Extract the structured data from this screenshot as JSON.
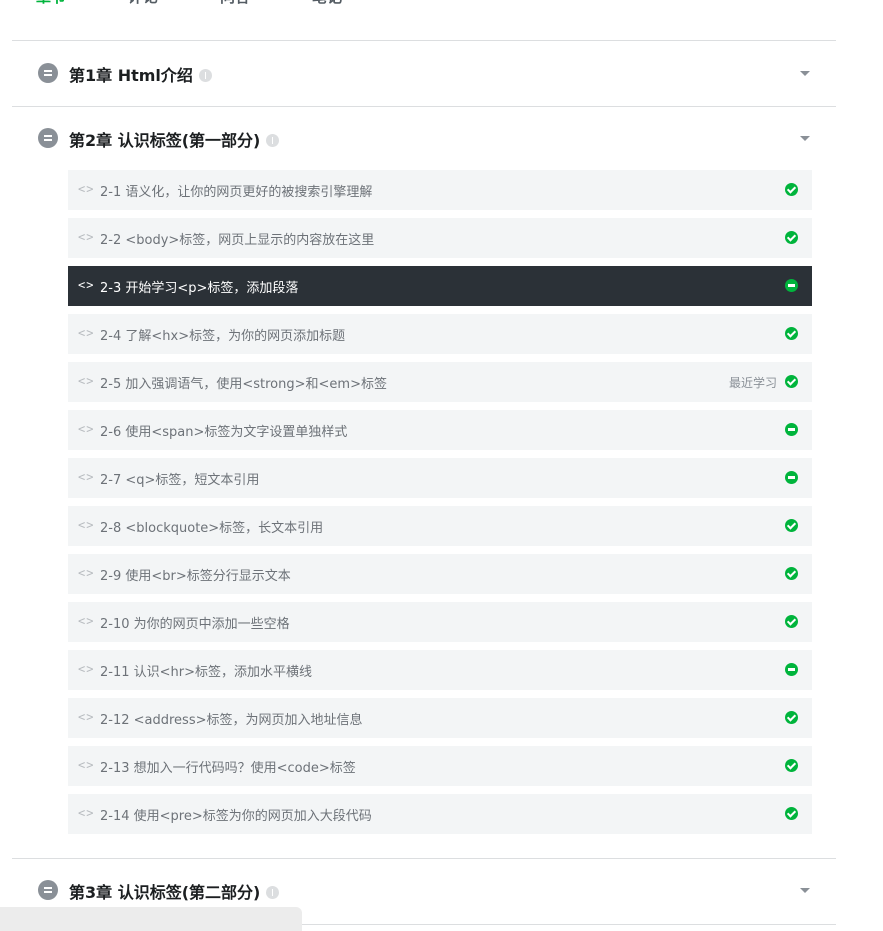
{
  "tabs": [
    "章节",
    "评论",
    "问答",
    "笔记"
  ],
  "chapters": [
    {
      "title": "第1章 Html介绍"
    },
    {
      "title": "第2章 认识标签(第一部分)"
    },
    {
      "title": "第3章 认识标签(第二部分)"
    }
  ],
  "lessons": [
    {
      "title": "2-1 语义化，让你的网页更好的被搜索引擎理解",
      "status": "done"
    },
    {
      "title": "2-2 <body>标签，网页上显示的内容放在这里",
      "status": "done"
    },
    {
      "title": "2-3 开始学习<p>标签，添加段落",
      "status": "half",
      "current": true
    },
    {
      "title": "2-4 了解<hx>标签，为你的网页添加标题",
      "status": "done"
    },
    {
      "title": "2-5 加入强调语气，使用<strong>和<em>标签",
      "status": "done",
      "recent_label": "最近学习"
    },
    {
      "title": "2-6 使用<span>标签为文字设置单独样式",
      "status": "half"
    },
    {
      "title": "2-7 <q>标签，短文本引用",
      "status": "half"
    },
    {
      "title": "2-8 <blockquote>标签，长文本引用",
      "status": "done"
    },
    {
      "title": "2-9 使用<br>标签分行显示文本",
      "status": "done"
    },
    {
      "title": "2-10 为你的网页中添加一些空格",
      "status": "done"
    },
    {
      "title": "2-11 认识<hr>标签，添加水平横线",
      "status": "half"
    },
    {
      "title": "2-12 <address>标签，为网页加入地址信息",
      "status": "done"
    },
    {
      "title": "2-13 想加入一行代码吗？使用<code>标签",
      "status": "done"
    },
    {
      "title": "2-14 使用<pre>标签为你的网页加入大段代码",
      "status": "done"
    }
  ],
  "colors": {
    "accent": "#00b43c",
    "current_bg": "#2b3137",
    "lesson_bg": "#f3f5f6"
  }
}
